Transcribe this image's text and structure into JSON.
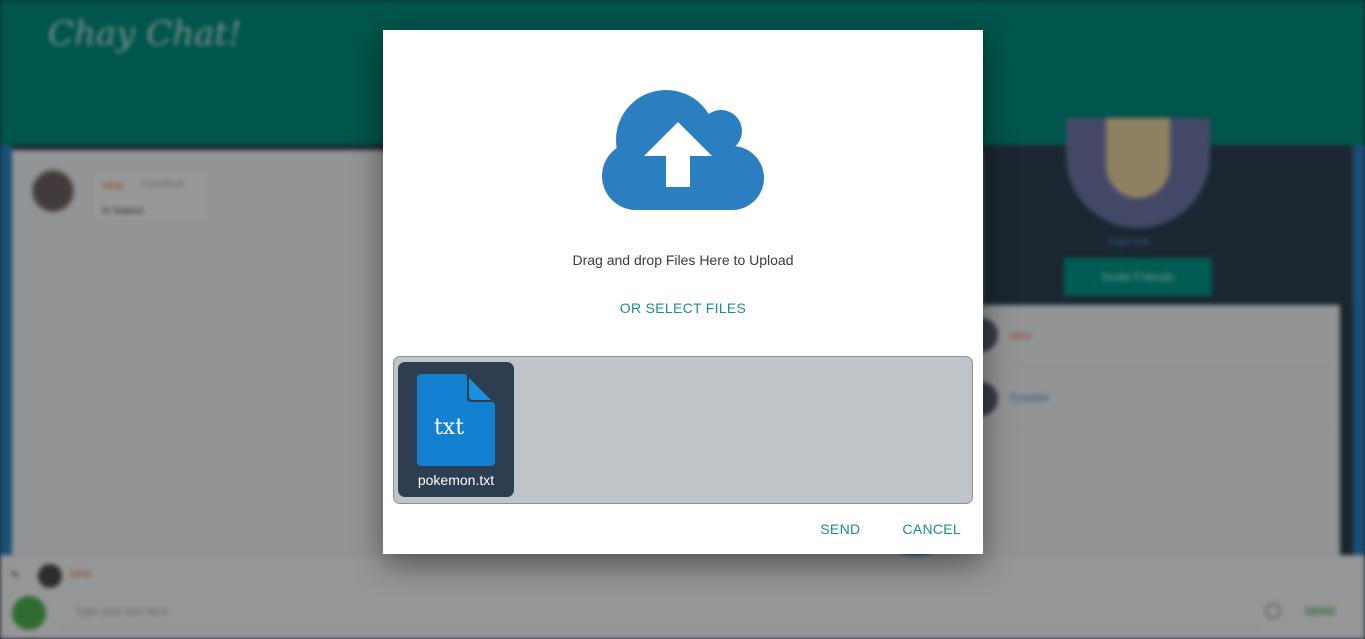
{
  "background": {
    "app_logo": "Chay Chat!",
    "message": {
      "name": "Isha",
      "time": "7/23/2018",
      "text": "hi babes"
    },
    "sidebar": {
      "username": "ingkrunti",
      "button_label": "Invite Friends",
      "contacts": [
        "Isha",
        "Eyadaw"
      ]
    },
    "bottom": {
      "user_name": "Isha",
      "input_placeholder": "Type your text here",
      "send_label": "SEND"
    }
  },
  "modal": {
    "drag_text": "Drag and drop Files Here to Upload",
    "select_files_label": "OR SELECT FILES",
    "files": [
      {
        "extension": "txt",
        "name": "pokemon.txt"
      }
    ],
    "send_label": "SEND",
    "cancel_label": "CANCEL"
  },
  "colors": {
    "header_teal": "#00897b",
    "accent_teal": "#1a8f8a",
    "cloud_blue": "#2b7fc0",
    "file_tile": "#2c3e50",
    "file_icon_blue": "#1380d0"
  },
  "icons": {
    "upload": "cloud-upload-icon",
    "file": "txt-file-icon"
  }
}
